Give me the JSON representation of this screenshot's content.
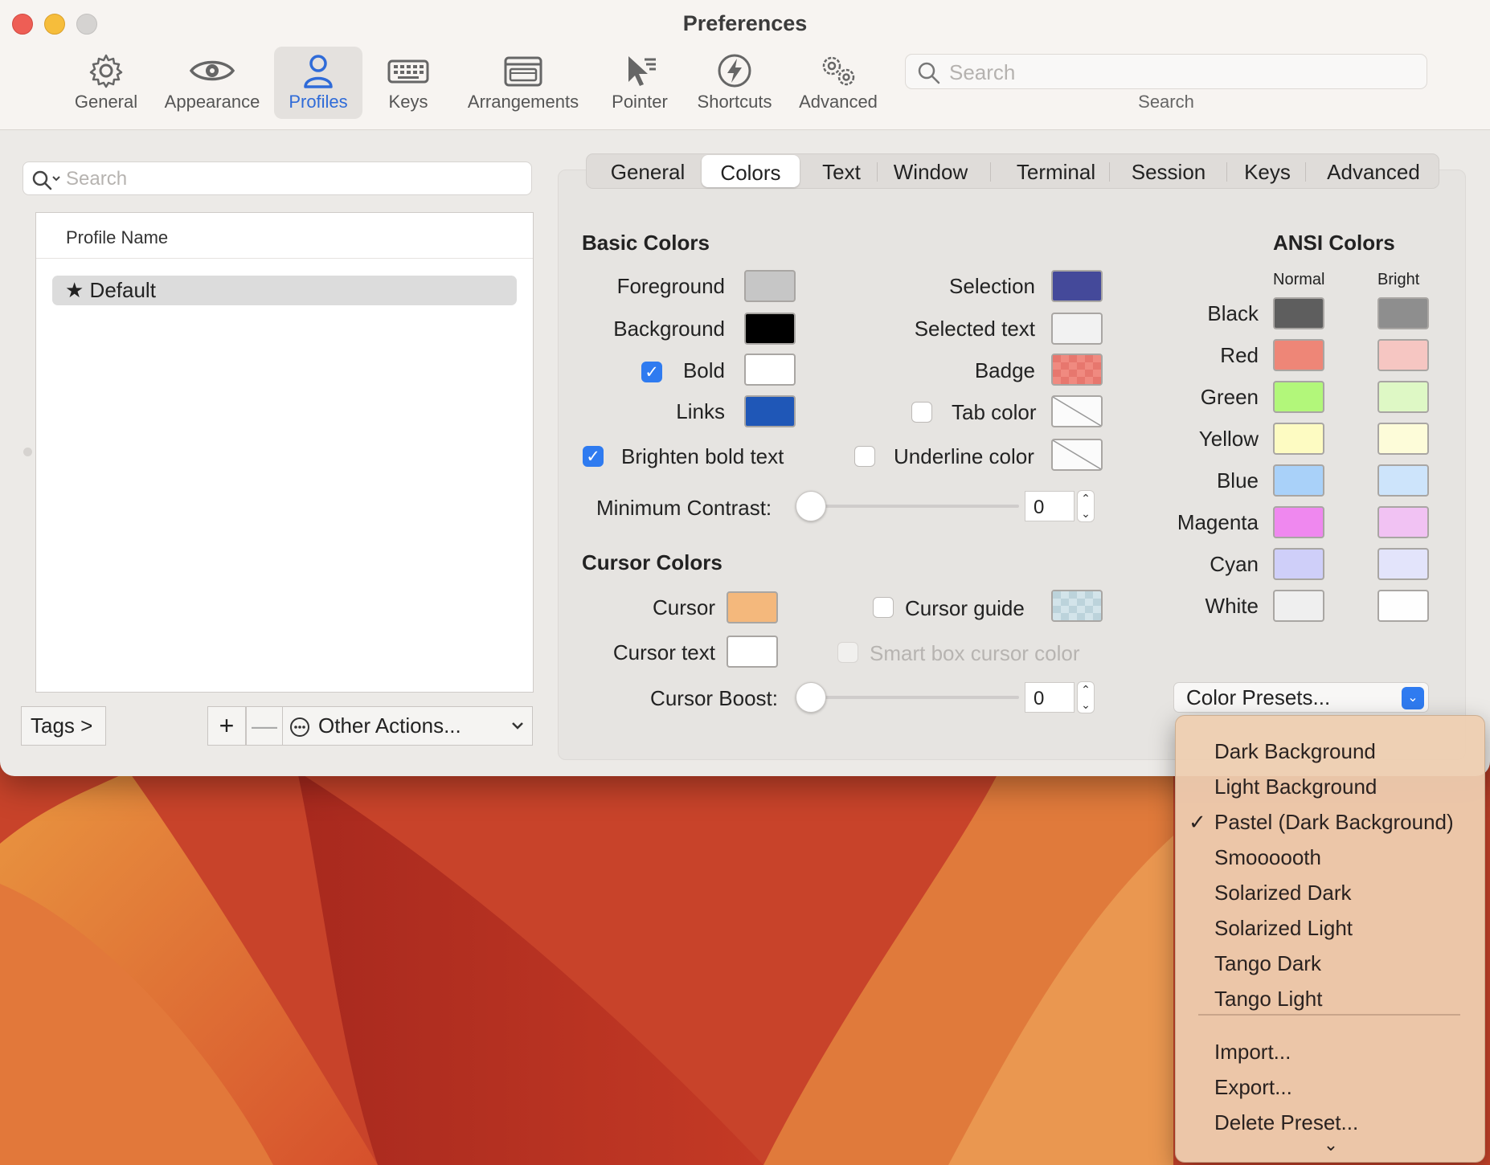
{
  "window": {
    "title": "Preferences"
  },
  "toolbar": {
    "items": [
      {
        "label": "General",
        "icon": "gear-icon"
      },
      {
        "label": "Appearance",
        "icon": "eye-icon"
      },
      {
        "label": "Profiles",
        "icon": "person-icon",
        "active": true
      },
      {
        "label": "Keys",
        "icon": "keyboard-icon"
      },
      {
        "label": "Arrangements",
        "icon": "window-arrangement-icon"
      },
      {
        "label": "Pointer",
        "icon": "pointer-icon"
      },
      {
        "label": "Shortcuts",
        "icon": "lightning-icon"
      },
      {
        "label": "Advanced",
        "icon": "gears-icon"
      }
    ],
    "search_placeholder": "Search",
    "search_label": "Search"
  },
  "profiles": {
    "search_placeholder": "Search",
    "column_header": "Profile Name",
    "items": [
      {
        "name": "Default",
        "icon": "star-icon"
      }
    ],
    "tags_button": "Tags >",
    "add_button": "+",
    "remove_button": "—",
    "other_actions": "Other Actions..."
  },
  "tabs": [
    "General",
    "Colors",
    "Text",
    "Window",
    "Terminal",
    "Session",
    "Keys",
    "Advanced"
  ],
  "active_tab": "Colors",
  "basic_colors": {
    "heading": "Basic Colors",
    "foreground": {
      "label": "Foreground",
      "color": "#c6c6c6"
    },
    "background": {
      "label": "Background",
      "color": "#000000"
    },
    "bold": {
      "label": "Bold",
      "color": "#ffffff",
      "checked": true
    },
    "links": {
      "label": "Links",
      "color": "#1f57b7"
    },
    "selection": {
      "label": "Selection",
      "color": "#44499a"
    },
    "selected_text": {
      "label": "Selected text",
      "color": "#f2f2f2"
    },
    "badge": {
      "label": "Badge",
      "color": "#f08a80"
    },
    "tab_color": {
      "label": "Tab color",
      "checked": false
    },
    "underline_color": {
      "label": "Underline color",
      "checked": false
    },
    "brighten_bold": {
      "label": "Brighten bold text",
      "checked": true
    },
    "min_contrast": {
      "label": "Minimum Contrast:",
      "value": "0"
    }
  },
  "cursor_colors": {
    "heading": "Cursor Colors",
    "cursor": {
      "label": "Cursor",
      "color": "#f4b87c"
    },
    "cursor_text": {
      "label": "Cursor text",
      "color": "#ffffff"
    },
    "cursor_guide": {
      "label": "Cursor guide",
      "checked": false,
      "color": "#d3e4ea"
    },
    "smart_box": {
      "label": "Smart box cursor color",
      "checked": false,
      "disabled": true
    },
    "cursor_boost": {
      "label": "Cursor Boost:",
      "value": "0"
    }
  },
  "ansi": {
    "heading": "ANSI Colors",
    "normal_label": "Normal",
    "bright_label": "Bright",
    "rows": [
      {
        "name": "Black",
        "normal": "#5e5e5e",
        "bright": "#8e8e8e"
      },
      {
        "name": "Red",
        "normal": "#ee8677",
        "bright": "#f6c6c2"
      },
      {
        "name": "Green",
        "normal": "#b2f77a",
        "bright": "#def8c5"
      },
      {
        "name": "Yellow",
        "normal": "#fdfbc2",
        "bright": "#fdfcd9"
      },
      {
        "name": "Blue",
        "normal": "#a9d1f9",
        "bright": "#cde4fb"
      },
      {
        "name": "Magenta",
        "normal": "#ef88ef",
        "bright": "#f1c2f3"
      },
      {
        "name": "Cyan",
        "normal": "#cfcff9",
        "bright": "#e3e4fb"
      },
      {
        "name": "White",
        "normal": "#efefef",
        "bright": "#fefefe"
      }
    ]
  },
  "presets": {
    "button_label": "Color Presets...",
    "menu_items": [
      {
        "label": "Dark Background"
      },
      {
        "label": "Light Background"
      },
      {
        "label": "Pastel (Dark Background)",
        "checked": true
      },
      {
        "label": "Smoooooth"
      },
      {
        "label": "Solarized Dark"
      },
      {
        "label": "Solarized Light"
      },
      {
        "label": "Tango Dark"
      },
      {
        "label": "Tango Light"
      }
    ],
    "actions": [
      "Import...",
      "Export...",
      "Delete Preset..."
    ],
    "checkmark": "✓",
    "more_indicator": "⌄"
  }
}
